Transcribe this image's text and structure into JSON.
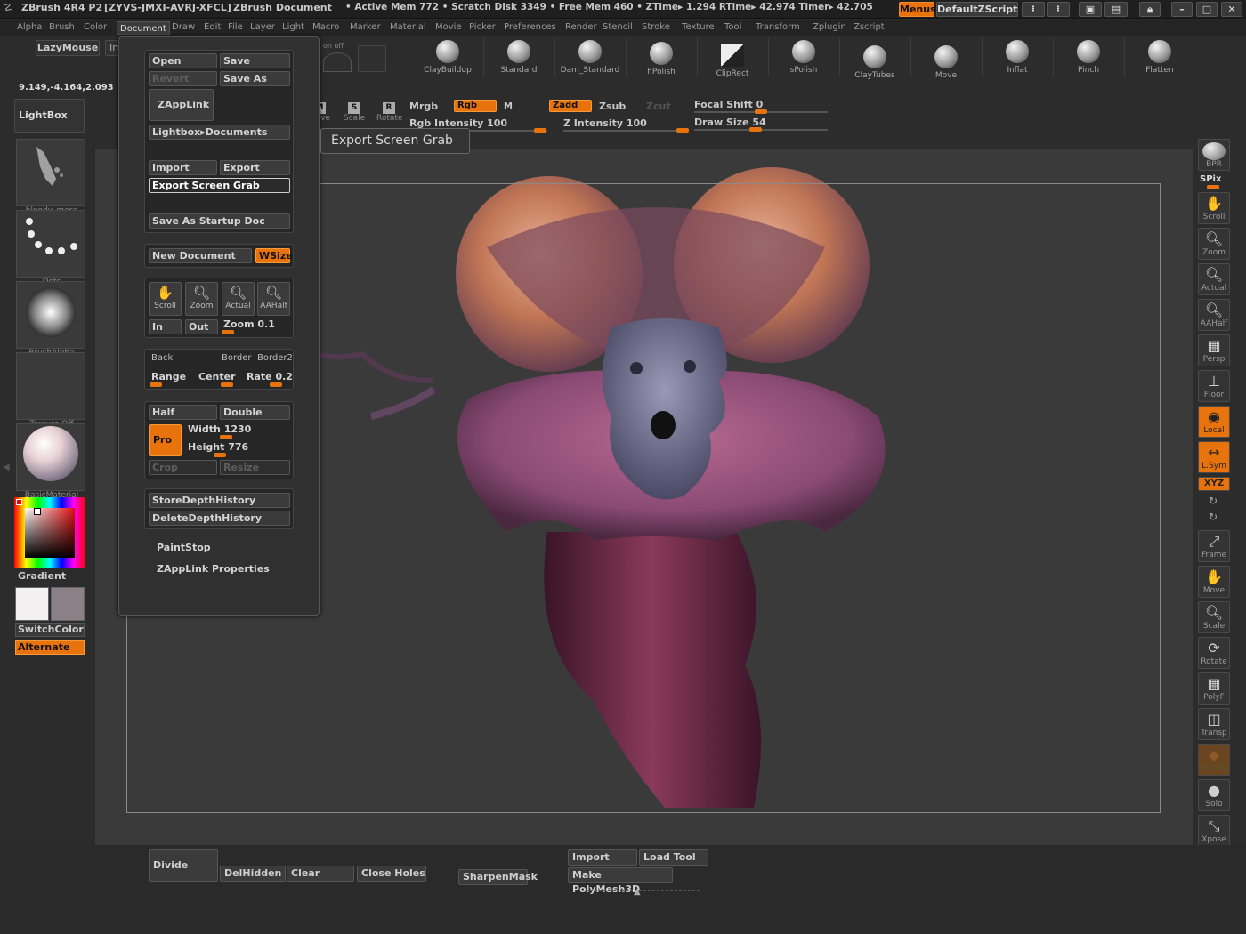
{
  "titlebar": {
    "app": "ZBrush 4R4 P2",
    "serial": "[ZYVS-JMXI-AVRJ-XFCL]",
    "doc": "ZBrush Document",
    "stats": "• Active Mem 772 • Scratch Disk 3349 • Free Mem 460 • ZTime▸ 1.294 RTime▸ 42.974 Timer▸ 42.705",
    "menus_btn": "Menus",
    "script_btn": "DefaultZScript"
  },
  "menubar": [
    "Alpha",
    "Brush",
    "Color",
    "Document",
    "Draw",
    "Edit",
    "File",
    "Layer",
    "Light",
    "Macro",
    "Marker",
    "Material",
    "Movie",
    "Picker",
    "Preferences",
    "Render",
    "Stencil",
    "Stroke",
    "Texture",
    "Tool",
    "Transform",
    "Zplugin",
    "Zscript"
  ],
  "menubar_active": "Document",
  "shelf": {
    "lazymouse": "LazyMouse",
    "import": "Import",
    "coords": "9.149,-4.164,2.093",
    "lightbox": "LightBox",
    "onoff": "on  off",
    "transform_btns": [
      {
        "label": "Move",
        "key": "M"
      },
      {
        "label": "Scale",
        "key": "S"
      },
      {
        "label": "Rotate",
        "key": "R"
      }
    ],
    "brushes": [
      "ClayBuildup",
      "Standard",
      "Dam_Standard",
      "hPolish",
      "ClipRect",
      "sPolish",
      "ClayTubes",
      "Move",
      "Inflat",
      "Pinch",
      "Flatten"
    ],
    "mrgb": "Mrgb",
    "rgb": "Rgb",
    "m": "M",
    "zadd": "Zadd",
    "zsub": "Zsub",
    "zcut": "Zcut",
    "rgb_intensity": "Rgb Intensity 100",
    "z_intensity": "Z Intensity 100",
    "focal_shift": "Focal Shift 0",
    "draw_size": "Draw Size 54"
  },
  "left": {
    "thumbs": [
      "bloody_mess",
      "Dots",
      "BrushAlpha",
      "Texture Off",
      "BasicMaterial"
    ],
    "gradient": "Gradient",
    "switchcolor": "SwitchColor",
    "alternate": "Alternate"
  },
  "right": {
    "bpr": "BPR",
    "spix": "SPix",
    "buttons": [
      "Scroll",
      "Zoom",
      "Actual",
      "AAHalf",
      "Persp",
      "Floor",
      "Local",
      "L.Sym",
      "XYZ",
      "Frame",
      "Move",
      "Scale",
      "Rotate",
      "PolyF",
      "Transp",
      "Ghost",
      "Solo",
      "Xpose"
    ]
  },
  "docmenu": {
    "open": "Open",
    "save": "Save",
    "revert": "Revert",
    "save_as": "Save As",
    "zapplink": "ZAppLink",
    "lightbox_docs": "Lightbox▸Documents",
    "import": "Import",
    "export": "Export",
    "export_screen_grab": "Export Screen Grab",
    "save_startup": "Save As Startup Doc",
    "new_document": "New Document",
    "wsize": "WSize",
    "scroll": "Scroll",
    "zoom": "Zoom",
    "actual": "Actual",
    "aahalf": "AAHalf",
    "in": "In",
    "out": "Out",
    "zoom_val": "Zoom 0.1",
    "back": "Back",
    "border": "Border",
    "border2": "Border2",
    "range": "Range",
    "center": "Center",
    "rate": "Rate 0.2",
    "half": "Half",
    "double": "Double",
    "pro": "Pro",
    "width": "Width 1230",
    "height": "Height 776",
    "crop": "Crop",
    "resize": "Resize",
    "store_depth": "StoreDepthHistory",
    "delete_depth": "DeleteDepthHistory",
    "paintstop": "PaintStop",
    "zapplink_props": "ZAppLink Properties"
  },
  "tooltip": "Export Screen Grab",
  "bottom": {
    "divide": "Divide",
    "delhidden": "DelHidden",
    "clear": "Clear",
    "close_holes": "Close Holes",
    "sharpenmask": "SharpenMask",
    "import": "Import",
    "load_tool": "Load Tool",
    "make_polymesh": "Make PolyMesh3D"
  },
  "colors": {
    "accent": "#e8730c"
  }
}
